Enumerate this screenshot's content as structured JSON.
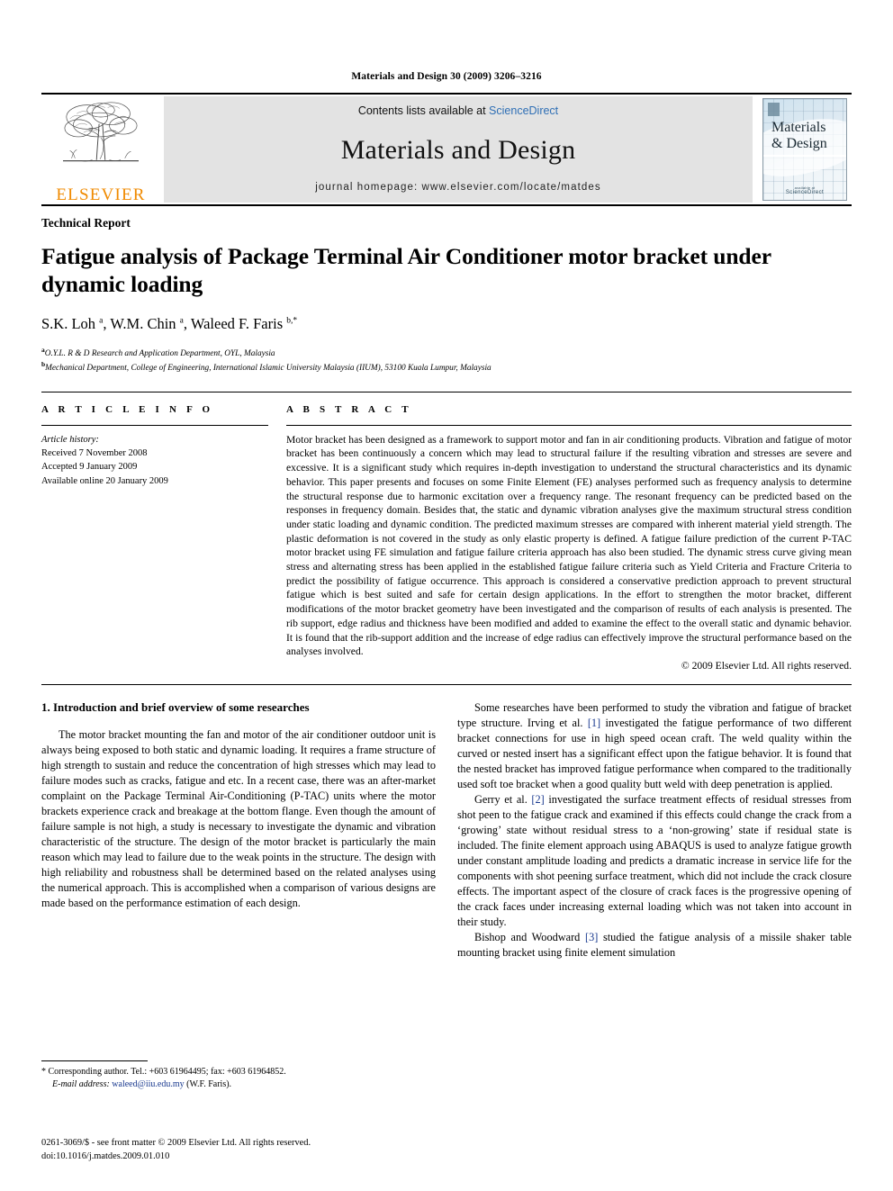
{
  "running_head": "Materials and Design 30 (2009) 3206–3216",
  "masthead": {
    "publisher_name": "ELSEVIER",
    "contents_prefix": "Contents lists available at ",
    "contents_link": "ScienceDirect",
    "journal_title": "Materials and Design",
    "homepage": "journal homepage: www.elsevier.com/locate/matdes",
    "cover": {
      "line1": "Materials",
      "line2": "& Design",
      "foot_small": "available at",
      "foot_brand": "ScienceDirect"
    }
  },
  "article": {
    "doctype": "Technical Report",
    "title": "Fatigue analysis of Package Terminal Air Conditioner motor bracket under dynamic loading",
    "authors_html": "S.K. Loh <sup>a</sup>, W.M. Chin <sup>a</sup>, Waleed F. Faris <sup>b,</sup><sup>*</sup>",
    "affiliation_a": "O.Y.L. R & D Research and Application Department, OYL, Malaysia",
    "affiliation_b": "Mechanical Department, College of Engineering, International Islamic University Malaysia (IIUM), 53100 Kuala Lumpur, Malaysia"
  },
  "article_info": {
    "heading": "A R T I C L E    I N F O",
    "history_label": "Article history:",
    "received": "Received 7 November 2008",
    "accepted": "Accepted 9 January 2009",
    "available": "Available online 20 January 2009"
  },
  "abstract": {
    "heading": "A B S T R A C T",
    "text": "Motor bracket has been designed as a framework to support motor and fan in air conditioning products. Vibration and fatigue of motor bracket has been continuously a concern which may lead to structural failure if the resulting vibration and stresses are severe and excessive. It is a significant study which requires in-depth investigation to understand the structural characteristics and its dynamic behavior. This paper presents and focuses on some Finite Element (FE) analyses performed such as frequency analysis to determine the structural response due to harmonic excitation over a frequency range. The resonant frequency can be predicted based on the responses in frequency domain. Besides that, the static and dynamic vibration analyses give the maximum structural stress condition under static loading and dynamic condition. The predicted maximum stresses are compared with inherent material yield strength. The plastic deformation is not covered in the study as only elastic property is defined. A fatigue failure prediction of the current P-TAC motor bracket using FE simulation and fatigue failure criteria approach has also been studied. The dynamic stress curve giving mean stress and alternating stress has been applied in the established fatigue failure criteria such as Yield Criteria and Fracture Criteria to predict the possibility of fatigue occurrence. This approach is considered a conservative prediction approach to prevent structural fatigue which is best suited and safe for certain design applications. In the effort to strengthen the motor bracket, different modifications of the motor bracket geometry have been investigated and the comparison of results of each analysis is presented. The rib support, edge radius and thickness have been modified and added to examine the effect to the overall static and dynamic behavior. It is found that the rib-support addition and the increase of edge radius can effectively improve the structural performance based on the analyses involved.",
    "copyright": "© 2009 Elsevier Ltd. All rights reserved."
  },
  "body": {
    "section_heading": "1. Introduction and brief overview of some researches",
    "left_para_1": "The motor bracket mounting the fan and motor of the air conditioner outdoor unit is always being exposed to both static and dynamic loading. It requires a frame structure of high strength to sustain and reduce the concentration of high stresses which may lead to failure modes such as cracks, fatigue and etc. In a recent case, there was an after-market complaint on the Package Terminal Air-Conditioning (P-TAC) units where the motor brackets experience crack and breakage at the bottom flange. Even though the amount of failure sample is not high, a study is necessary to investigate the dynamic and vibration characteristic of the structure. The design of the motor bracket is particularly the main reason which may lead to failure due to the weak points in the structure. The design with high reliability and robustness shall be determined based on the related analyses using the numerical approach. This is accomplished when a comparison of various designs are made based on the performance estimation of each design.",
    "right_para_1_a": "Some researches have been performed to study the vibration and fatigue of bracket type structure. Irving et al. ",
    "right_para_1_ref": "[1]",
    "right_para_1_b": " investigated the fatigue performance of two different bracket connections for use in high speed ocean craft. The weld quality within the curved or nested insert has a significant effect upon the fatigue behavior. It is found that the nested bracket has improved fatigue performance when compared to the traditionally used soft toe bracket when a good quality butt weld with deep penetration is applied.",
    "right_para_2_a": "Gerry et al. ",
    "right_para_2_ref": "[2]",
    "right_para_2_b": " investigated the surface treatment effects of residual stresses from shot peen to the fatigue crack and examined if this effects could change the crack from a ‘growing’ state without residual stress to a ‘non-growing’ state if residual state is included. The finite element approach using ABAQUS is used to analyze fatigue growth under constant amplitude loading and predicts a dramatic increase in service life for the components with shot peening surface treatment, which did not include the crack closure effects. The important aspect of the closure of crack faces is the progressive opening of the crack faces under increasing external loading which was not taken into account in their study.",
    "right_para_3_a": "Bishop and Woodward ",
    "right_para_3_ref": "[3]",
    "right_para_3_b": " studied the fatigue analysis of a missile shaker table mounting bracket using finite element simulation"
  },
  "footnote": {
    "star": "*",
    "corresponding": "Corresponding author. Tel.: +603 61964495; fax: +603 61964852.",
    "email_label": "E-mail address:",
    "email": "waleed@iiu.edu.my",
    "email_attrib": "(W.F. Faris)."
  },
  "footer": {
    "issn_line": "0261-3069/$ - see front matter © 2009 Elsevier Ltd. All rights reserved.",
    "doi_line": "doi:10.1016/j.matdes.2009.01.010"
  },
  "colors": {
    "elsevier_orange": "#F08A00",
    "sciencedirect_blue": "#2F6FB5",
    "link_blue": "#1A3A8F",
    "masthead_grey": "#E3E3E3"
  }
}
